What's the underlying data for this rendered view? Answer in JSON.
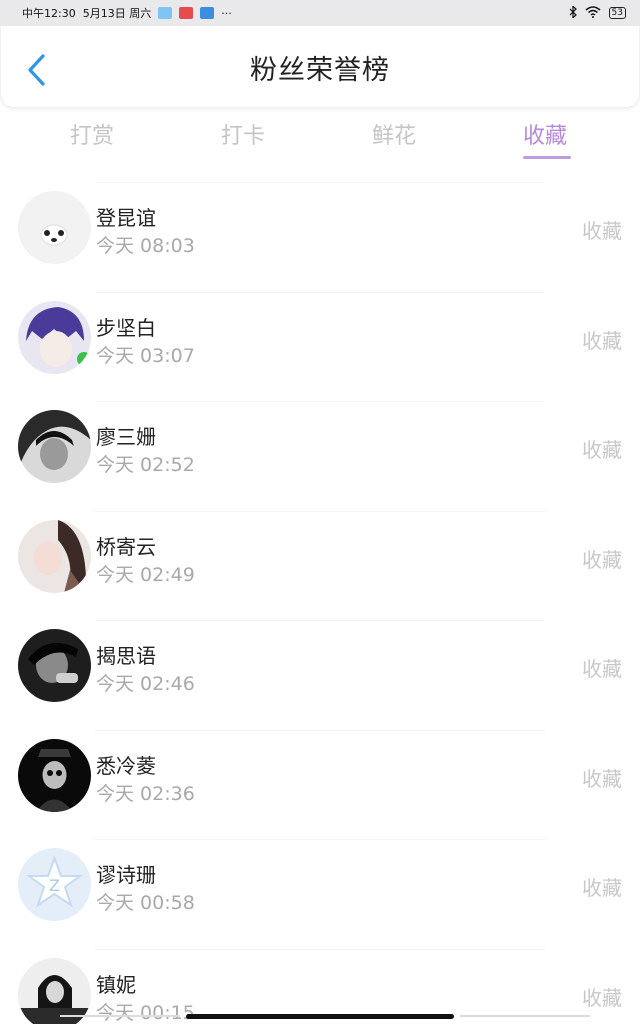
{
  "status_bar": {
    "time": "中午12:30",
    "date": "5月13日 周六",
    "more": "···",
    "battery": "53",
    "app_icons": [
      "#7fc4f3",
      "#e74c4c",
      "#3a8fe0"
    ]
  },
  "header": {
    "title": "粉丝荣誉榜",
    "back_icon": "chevron-left-icon",
    "accent": "#2f95e8"
  },
  "tabs": [
    {
      "label": "打赏",
      "active": false
    },
    {
      "label": "打卡",
      "active": false
    },
    {
      "label": "鲜花",
      "active": false
    },
    {
      "label": "收藏",
      "active": true
    }
  ],
  "tab_active_color": "#b58bd9",
  "fans": [
    {
      "name": "登昆谊",
      "time": "今天 08:03",
      "action": "收藏"
    },
    {
      "name": "步坚白",
      "time": "今天 03:07",
      "action": "收藏"
    },
    {
      "name": "廖三姗",
      "time": "今天 02:52",
      "action": "收藏"
    },
    {
      "name": "桥寄云",
      "time": "今天 02:49",
      "action": "收藏"
    },
    {
      "name": "揭思语",
      "time": "今天 02:46",
      "action": "收藏"
    },
    {
      "name": "悉冷菱",
      "time": "今天 02:36",
      "action": "收藏"
    },
    {
      "name": "谬诗珊",
      "time": "今天 00:58",
      "action": "收藏"
    },
    {
      "name": "镇妮",
      "time": "今天 00:15",
      "action": "收藏"
    }
  ]
}
